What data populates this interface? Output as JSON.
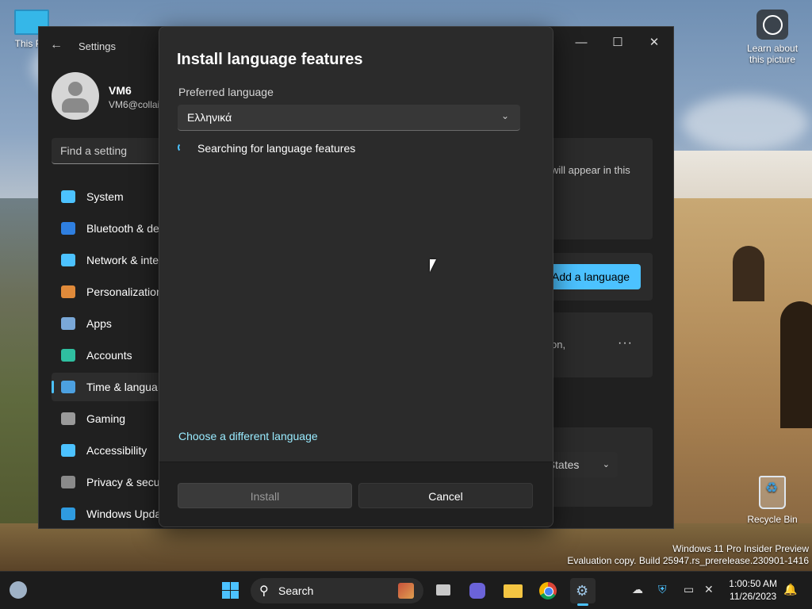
{
  "desktop": {
    "this_pc_label": "This PC",
    "learn_label": "Learn about this picture",
    "recycle_bin_label": "Recycle Bin",
    "watermark_line1": "Windows 11 Pro Insider Preview",
    "watermark_line2": "Evaluation copy. Build 25947.rs_prerelease.230901-1416"
  },
  "settings": {
    "title": "Settings",
    "user_name": "VM6",
    "user_email": "VM6@collai",
    "find_placeholder": "Find a setting",
    "nav": [
      {
        "label": "System",
        "icon": "monitor-icon",
        "color": "#4cc2ff"
      },
      {
        "label": "Bluetooth & de",
        "icon": "bluetooth-icon",
        "color": "#2f7fe0"
      },
      {
        "label": "Network & inte",
        "icon": "wifi-icon",
        "color": "#4cc2ff"
      },
      {
        "label": "Personalization",
        "icon": "brush-icon",
        "color": "#e08a3a"
      },
      {
        "label": "Apps",
        "icon": "apps-icon",
        "color": "#7aa8d8"
      },
      {
        "label": "Accounts",
        "icon": "person-icon",
        "color": "#2fbfa0"
      },
      {
        "label": "Time & langua",
        "icon": "globe-clock-icon",
        "color": "#4ca0e0"
      },
      {
        "label": "Gaming",
        "icon": "controller-icon",
        "color": "#9a9a9a"
      },
      {
        "label": "Accessibility",
        "icon": "accessibility-icon",
        "color": "#4cc2ff"
      },
      {
        "label": "Privacy & secu",
        "icon": "shield-icon",
        "color": "#8a8a8a"
      },
      {
        "label": "Windows Upda",
        "icon": "update-icon",
        "color": "#2f9be0"
      }
    ],
    "card1_text": "will appear in this",
    "add_language_label": "Add a language",
    "card2_text": "on,",
    "more_label": "···",
    "region_value": "d States"
  },
  "dialog": {
    "title": "Install language features",
    "preferred_label": "Preferred language",
    "selected_language": "Ελληνικά",
    "status_text": "Searching for language features",
    "choose_link": "Choose a different language",
    "install_label": "Install",
    "cancel_label": "Cancel"
  },
  "taskbar": {
    "search_label": "Search",
    "time": "1:00:50 AM",
    "date": "11/26/2023"
  },
  "colors": {
    "accent": "#4cc2ff",
    "link": "#99ebff"
  }
}
